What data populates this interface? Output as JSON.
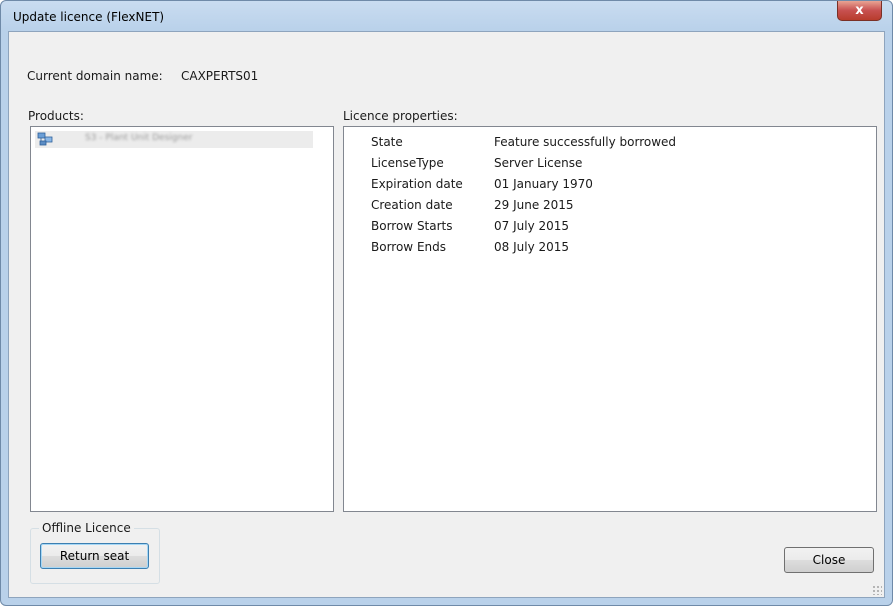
{
  "window": {
    "title": "Update licence (FlexNET)",
    "close_glyph": "x"
  },
  "domain": {
    "label": "Current domain name:",
    "value": "CAXPERTS01"
  },
  "products": {
    "label": "Products:",
    "items": [
      {
        "name": "S3 - Plant Unit Designer",
        "icon": "server-network-icon"
      }
    ]
  },
  "licence_properties": {
    "label": "Licence properties:",
    "rows": [
      {
        "key": "State",
        "value": "Feature successfully borrowed"
      },
      {
        "key": "LicenseType",
        "value": "Server License"
      },
      {
        "key": "Expiration date",
        "value": "01 January 1970"
      },
      {
        "key": "Creation date",
        "value": "29 June 2015"
      },
      {
        "key": "Borrow Starts",
        "value": "07 July 2015"
      },
      {
        "key": "Borrow Ends",
        "value": "08 July 2015"
      }
    ]
  },
  "offline": {
    "group_title": "Offline Licence",
    "return_button": "Return seat"
  },
  "footer": {
    "close_button": "Close"
  },
  "colors": {
    "title_bar": "#c9dcf0",
    "client_bg": "#f0f0f0",
    "close_button_red": "#c75050",
    "focus_border": "#3c7fb1"
  }
}
